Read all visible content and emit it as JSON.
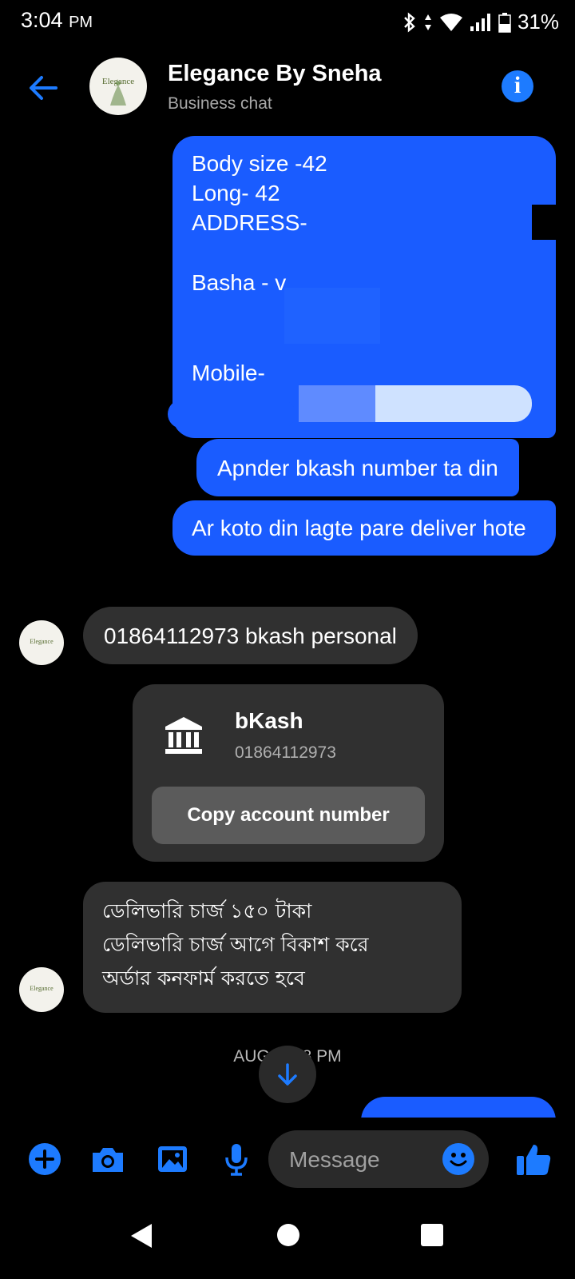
{
  "status": {
    "time": "3:04",
    "ampm": "PM",
    "battery": "31%"
  },
  "header": {
    "title": "Elegance By Sneha",
    "subtitle": "Business chat",
    "avatar_text": "Elegance"
  },
  "messages": {
    "order_details": {
      "line1": "Body size -42",
      "line2": "Long- 42",
      "line3": "ADDRESS- N",
      "line4": "Basha - v",
      "line5": "Mobile-"
    },
    "ask_bkash": "Apnder bkash number ta din",
    "ask_delivery": "Ar koto din lagte pare deliver hote",
    "reply_bkash": "01864112973 bkash personal",
    "delivery_charge": {
      "line1": "ডেলিভারি চার্জ ১৫০ টাকা",
      "line2": "ডেলিভারি চার্জ আগে বিকাশ করে",
      "line3": "অর্ডার কনফার্ম করতে হবে"
    },
    "timestamp": "AUG 7, 58 PM"
  },
  "payment_card": {
    "title": "bKash",
    "account": "01864112973",
    "button": "Copy account number"
  },
  "composer": {
    "placeholder": "Message"
  },
  "colors": {
    "accent": "#1d7bff",
    "outgoing_bubble": "#1a5cff",
    "incoming_bubble": "#303030"
  }
}
